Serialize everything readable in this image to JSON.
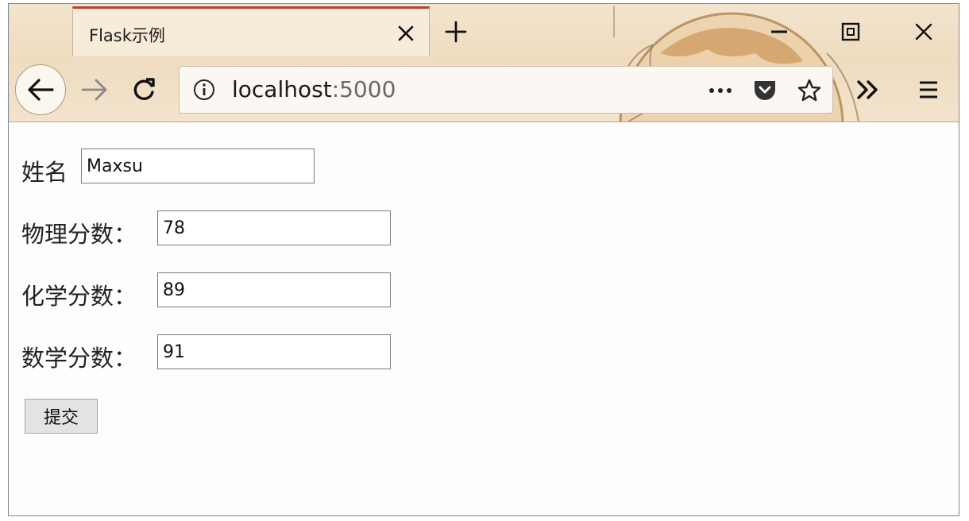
{
  "browser": {
    "tab_title": "Flask示例",
    "url_host": "localhost",
    "url_port": ":5000"
  },
  "form": {
    "fields": [
      {
        "label": "姓名",
        "value": "Maxsu"
      },
      {
        "label": "物理分数：",
        "value": "78"
      },
      {
        "label": "化学分数：",
        "value": "89"
      },
      {
        "label": "数学分数：",
        "value": "91"
      }
    ],
    "submit_label": "提交"
  },
  "theme": {
    "accent": "#b4442f",
    "chrome_bg": "#efdcc0"
  }
}
